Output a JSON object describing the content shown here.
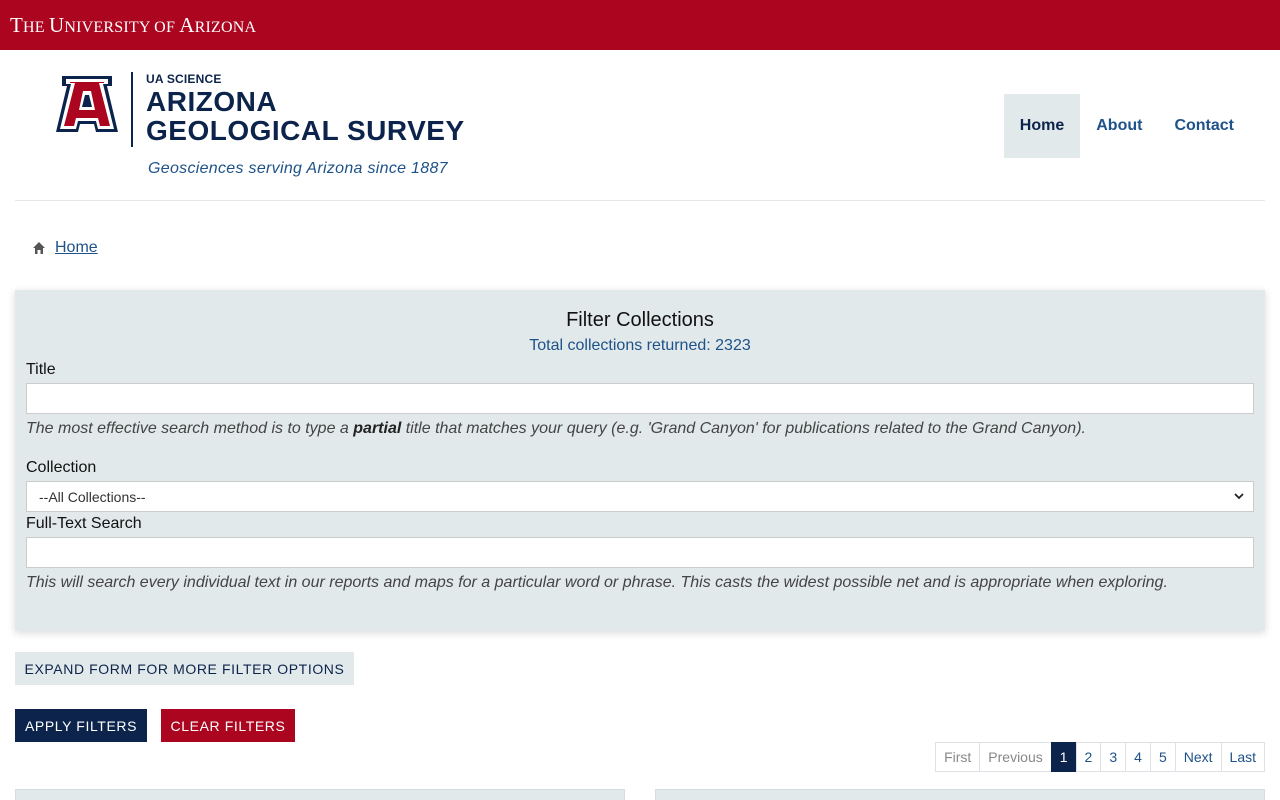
{
  "topbar": {
    "university_name_first": "T",
    "university_name_small_1": "HE ",
    "university_name_u": "U",
    "university_name_small_2": "NIVERSITY OF ",
    "university_name_a": "A",
    "university_name_small_3": "RIZONA"
  },
  "header": {
    "ua_science": "UA SCIENCE",
    "title_line_1": "ARIZONA",
    "title_line_2": "GEOLOGICAL SURVEY",
    "tagline": "Geosciences serving Arizona since 1887",
    "logo_letter": "A"
  },
  "nav": {
    "items": [
      {
        "label": "Home"
      },
      {
        "label": "About"
      },
      {
        "label": "Contact"
      }
    ]
  },
  "breadcrumb": {
    "home_label": "Home"
  },
  "filter": {
    "heading": "Filter Collections",
    "count_text": "Total collections returned: 2323",
    "title_label": "Title",
    "title_value": "",
    "title_help_before": "The most effective search method is to type a ",
    "title_help_bold": "partial",
    "title_help_after": " title that matches your query (e.g. 'Grand Canyon' for publications related to the Grand Canyon).",
    "collection_label": "Collection",
    "collection_selected": "--All Collections--",
    "fulltext_label": "Full-Text Search",
    "fulltext_value": "",
    "fulltext_help": "This will search every individual text in our reports and maps for a particular word or phrase. This casts the widest possible net and is appropriate when exploring."
  },
  "buttons": {
    "expand": "EXPAND FORM FOR MORE FILTER OPTIONS",
    "apply": "APPLY FILTERS",
    "clear": "CLEAR FILTERS"
  },
  "pagination": {
    "first": "First",
    "previous": "Previous",
    "pages": [
      "1",
      "2",
      "3",
      "4",
      "5"
    ],
    "next": "Next",
    "last": "Last",
    "current": "1"
  },
  "colors": {
    "brand_red": "#ab0520",
    "brand_navy": "#0c234b",
    "link_blue": "#1e5288",
    "panel_bg": "#e2e9eb"
  },
  "icons": {
    "breadcrumb": "home-icon",
    "select": "chevron-down-icon",
    "logo": "block-a-logo-icon"
  }
}
